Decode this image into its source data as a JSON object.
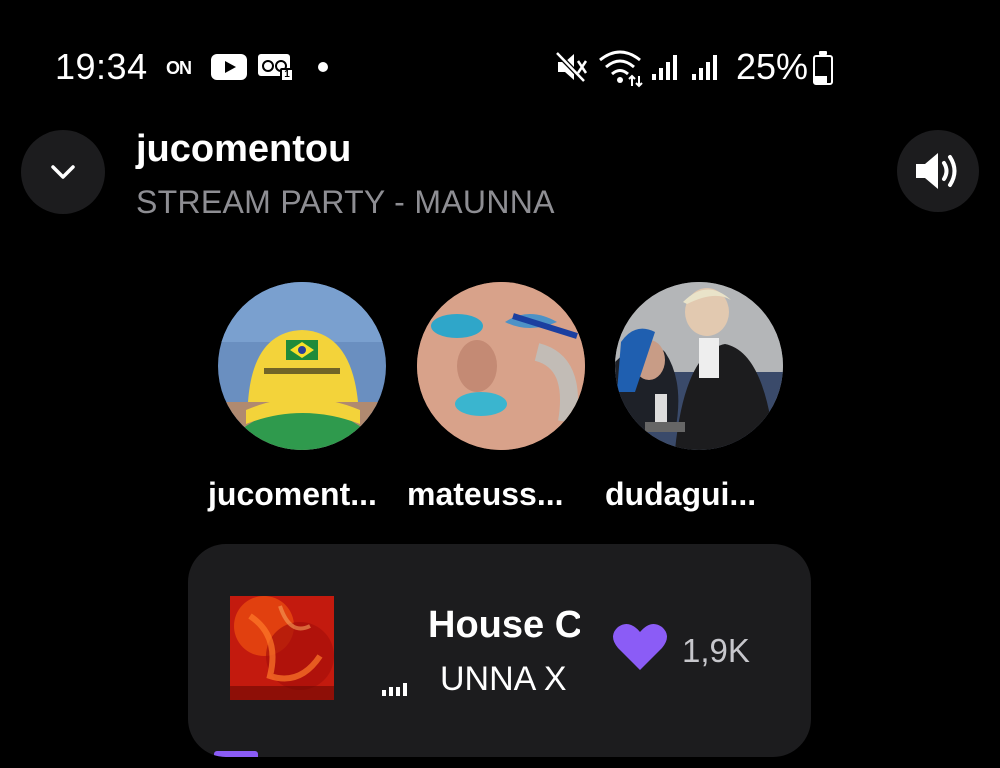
{
  "status_bar": {
    "time": "19:34",
    "on_label": "ON",
    "voicemail_badge": "1",
    "battery_percent": "25%",
    "icons": [
      "on-icon",
      "youtube-icon",
      "voicemail-icon",
      "dot-icon",
      "mute-icon",
      "wifi-icon",
      "signal-icon",
      "signal-icon",
      "battery-icon"
    ]
  },
  "header": {
    "title": "jucomentou",
    "subtitle": "STREAM PARTY - MAUNNA",
    "collapse_icon": "chevron-down-icon",
    "volume_icon": "volume-icon"
  },
  "participants": [
    {
      "name": "jucoment..."
    },
    {
      "name": "mateuss..."
    },
    {
      "name": "dudagui..."
    }
  ],
  "now_playing": {
    "title": "House C",
    "artist": "UNNA X",
    "likes": "1,9K",
    "progress": 0.07,
    "accent_color": "#8b5cf6"
  },
  "colors": {
    "background": "#000000",
    "card": "#1c1c1e",
    "subtitle": "#8e8e93",
    "accent": "#8b5cf6"
  }
}
